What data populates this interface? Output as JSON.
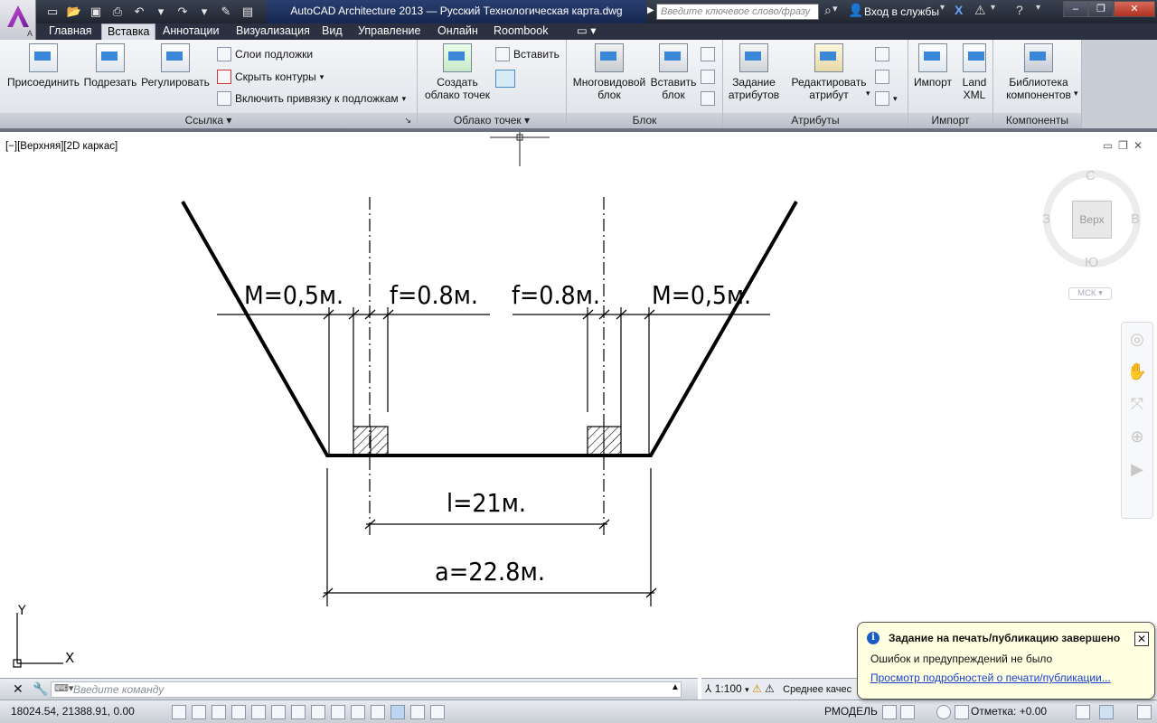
{
  "app": {
    "title": "AutoCAD Architecture 2013 — Русский   Технологическая карта.dwg",
    "search_placeholder": "Введите ключевое слово/фразу",
    "login": "Вход в службы",
    "app_letter": "A"
  },
  "tabs": [
    "Главная",
    "Вставка",
    "Аннотации",
    "Визуализация",
    "Вид",
    "Управление",
    "Онлайн",
    "Roombook"
  ],
  "active_tab": "Вставка",
  "ribbon": {
    "link_panel": {
      "title": "Ссылка",
      "attach": "Присоединить",
      "clip": "Подрезать",
      "adjust": "Регулировать",
      "underlay_layers": "Слои подложки",
      "hide_frames": "Скрыть контуры",
      "snap_underlays": "Включить привязку к подложкам"
    },
    "pointcloud_panel": {
      "title": "Облако точек",
      "create_line1": "Создать",
      "create_line2": "облако точек",
      "insert": "Вставить"
    },
    "block_panel": {
      "title": "Блок",
      "multiview_line1": "Многовидовой",
      "multiview_line2": "блок",
      "insert_line1": "Вставить",
      "insert_line2": "блок"
    },
    "attr_panel": {
      "title": "Атрибуты",
      "define_line1": "Задание",
      "define_line2": "атрибутов",
      "edit_line1": "Редактировать",
      "edit_line2": "атрибут"
    },
    "import_panel": {
      "title": "Импорт",
      "import": "Импорт",
      "landxml_line1": "Land",
      "landxml_line2": "XML"
    },
    "components_panel": {
      "title": "Компоненты",
      "lib_line1": "Библиотека",
      "lib_line2": "компонентов"
    }
  },
  "viewport": {
    "label": "[−][Верхняя][2D каркас]",
    "viewcube": {
      "n": "С",
      "s": "Ю",
      "w": "З",
      "e": "В",
      "top": "Верх"
    },
    "ucs_menu": "МСК"
  },
  "drawing": {
    "dim_m_left": "M=0,5м.",
    "dim_f_left": "f=0.8м.",
    "dim_f_right": "f=0.8м.",
    "dim_m_right": "M=0,5м.",
    "dim_l": "l=21м.",
    "dim_a": "a=22.8м.",
    "ucs_x": "X",
    "ucs_y": "Y"
  },
  "command": {
    "placeholder": "Введите команду",
    "scale": "1:100",
    "quality": "Среднее качес"
  },
  "status": {
    "coords": "18024.54, 21388.91, 0.00",
    "model": "РМОДЕЛЬ",
    "elevation": "Отметка: +0.00"
  },
  "notification": {
    "title": "Задание на печать/публикацию завершено",
    "message": "Ошибок и предупреждений не было",
    "link": "Просмотр подробностей о печати/публикации..."
  }
}
